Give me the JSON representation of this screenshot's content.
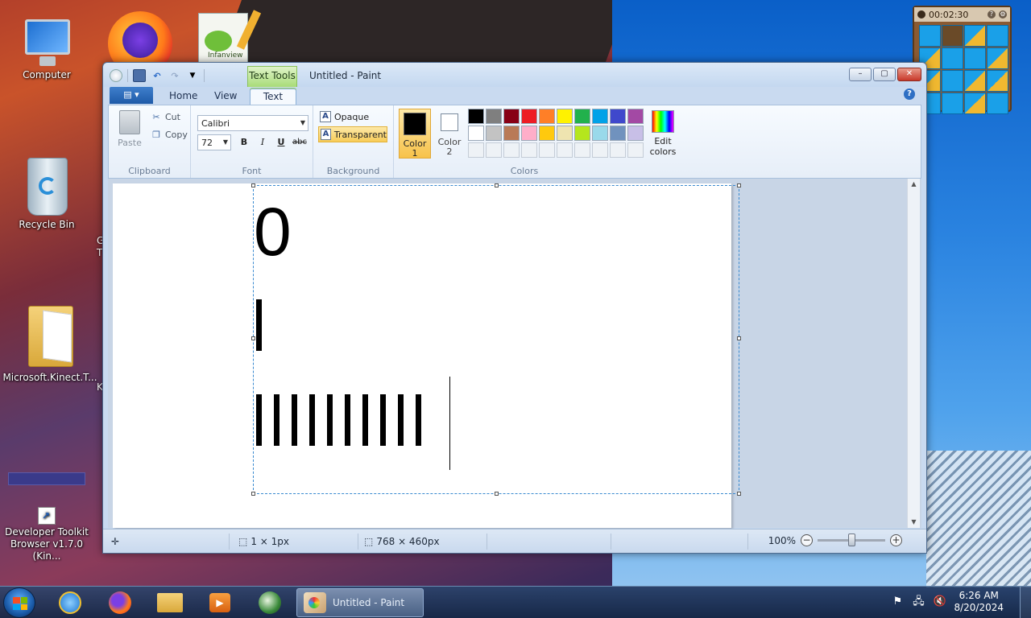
{
  "desktop": {
    "icons": [
      {
        "label": "Computer"
      },
      {
        "label": "Recycle Bin"
      },
      {
        "label": "Microsoft.Kinect.T..."
      },
      {
        "label": "Developer Toolkit Browser v1.7.0 (Kin..."
      }
    ],
    "partial_labels": [
      "G",
      "T",
      "K"
    ],
    "notepad_label": "Infanview"
  },
  "gadget": {
    "time": "00:02:30",
    "help_label": "?",
    "settings_label": "⚙"
  },
  "window": {
    "title": "Untitled - Paint",
    "contextual_tab": "Text Tools",
    "tabs": [
      {
        "label": "Home",
        "active": false
      },
      {
        "label": "View",
        "active": false
      },
      {
        "label": "Text",
        "active": true
      }
    ],
    "help_label": "?",
    "controls": {
      "minimize": "–",
      "maximize": "▢",
      "close": "✕"
    }
  },
  "ribbon": {
    "clipboard": {
      "title": "Clipboard",
      "paste": "Paste",
      "cut": "Cut",
      "copy": "Copy"
    },
    "font": {
      "title": "Font",
      "family": "Calibri",
      "size": "72",
      "bold": "B",
      "italic": "I",
      "underline": "U",
      "strike": "abc"
    },
    "background": {
      "title": "Background",
      "opaque": "Opaque",
      "transparent": "Transparent",
      "selected": "Transparent"
    },
    "colors": {
      "title": "Colors",
      "color1_label": "Color 1",
      "color2_label": "Color 2",
      "color1": "#000000",
      "color2": "#ffffff",
      "edit_label": "Edit colors",
      "palette_row1": [
        "#000000",
        "#7f7f7f",
        "#880015",
        "#ed1c24",
        "#ff7f27",
        "#fff200",
        "#22b14c",
        "#00a2e8",
        "#3f48cc",
        "#a349a4"
      ],
      "palette_row2": [
        "#ffffff",
        "#c3c3c3",
        "#b97a57",
        "#ffaec9",
        "#ffc90e",
        "#efe4b0",
        "#b5e61d",
        "#99d9ea",
        "#7092be",
        "#c8bfe7"
      ]
    }
  },
  "canvas": {
    "text_lines": [
      "0",
      "l",
      "llllllllll"
    ]
  },
  "statusbar": {
    "selection_size": "1 × 1px",
    "canvas_size": "768 × 460px",
    "zoom": "100%",
    "zoom_percent": 100
  },
  "taskbar": {
    "active_app": "Untitled - Paint",
    "time": "6:26 AM",
    "date": "8/20/2024",
    "pinned": [
      "internet-explorer",
      "firefox",
      "file-explorer",
      "media-player",
      "kinect-studio"
    ]
  }
}
